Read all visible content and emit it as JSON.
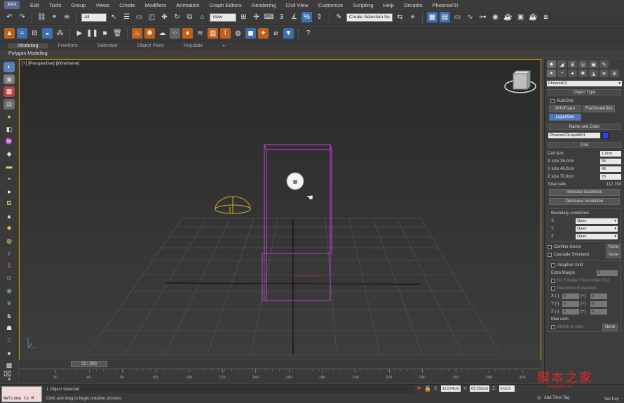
{
  "menubar": {
    "logo": "MAX",
    "items": [
      "Edit",
      "Tools",
      "Group",
      "Views",
      "Create",
      "Modifiers",
      "Animation",
      "Graph Editors",
      "Rendering",
      "Civil View",
      "Customize",
      "Scripting",
      "Help",
      "Ornatrix",
      "PhoenixFD"
    ]
  },
  "toolbar1": {
    "selection_filter": "All",
    "ref_coord": "View",
    "named_selection": "Create Selection Se"
  },
  "ribbon": {
    "tabs": [
      "Modeling",
      "Freeform",
      "Selection",
      "Object Paint",
      "Populate"
    ],
    "sub_label": "Polygon Modeling"
  },
  "viewport": {
    "label": "[+] [Perspective] [Wireframe]"
  },
  "command_panel": {
    "plugin_dropdown": "PhoenixFD",
    "object_type": {
      "title": "Object Type",
      "autogrid": "AutoGrid",
      "buttons": [
        "PHXFoam",
        "FireSmokeSim",
        "LiquidSim"
      ]
    },
    "name_color": {
      "title": "Name and Color",
      "name": "PhoenixFDLiquid001",
      "color": "#3a3aff"
    },
    "grid": {
      "title": "Grid",
      "rows": [
        {
          "label": "Cell size",
          "value": "1.0cm"
        },
        {
          "label": "X size 35.0cm",
          "value": "35"
        },
        {
          "label": "Y size 46.0cm",
          "value": "46"
        },
        {
          "label": "Z size 70.0cm",
          "value": "70"
        }
      ],
      "total_cells_label": "Total cells",
      "total_cells_value": "112 700",
      "increase": "Increase resolution",
      "decrease": "Decrease resolution",
      "boundary_title": "Boundary conditions",
      "boundaries": [
        {
          "axis": "X",
          "value": "Open"
        },
        {
          "axis": "Y",
          "value": "Open"
        },
        {
          "axis": "Z",
          "value": "Open"
        }
      ],
      "confine_geom": "Confine Geom",
      "cascade_simulator": "Cascade Simulator",
      "none1": "None",
      "none2": "None",
      "adaptive_grid": "Adaptive Grid",
      "extra_margin": "Extra Margin",
      "extra_margin_value": "0",
      "no_smaller": "No Smaller Than Initial Grid",
      "max_expansion": "Maximum Expansion",
      "expansion_rows": [
        {
          "neg": "X (-)",
          "neg_val": "0",
          "pos": "(+)",
          "pos_val": "0"
        },
        {
          "neg": "Y (-)",
          "neg_val": "0",
          "pos": "(+)",
          "pos_val": "0"
        },
        {
          "neg": "Z (-)",
          "neg_val": "0",
          "pos": "(+)",
          "pos_val": "0"
        }
      ],
      "max_cells": "Max cells",
      "shrink": "Shrink to view",
      "none3": "None"
    }
  },
  "timeline": {
    "frame": "22 / 300",
    "ticks": [
      "20",
      "40",
      "60",
      "80",
      "100",
      "120",
      "140",
      "160",
      "180",
      "200",
      "220",
      "240",
      "260",
      "280",
      "300"
    ]
  },
  "status": {
    "maxscript": "Welcome to M",
    "selected": "1 Object Selected",
    "prompt": "Click and drag to begin creation process",
    "x_label": "X:",
    "x_value": "11.074cm",
    "y_label": "Y:",
    "y_value": "05.253cm",
    "z_label": "Z:",
    "z_value": "0.0cm",
    "add_time_tag": "Add Time Tag",
    "set_key": "Set Key"
  },
  "watermark": {
    "title": "脚本之家",
    "url": "www.jb51.net"
  }
}
